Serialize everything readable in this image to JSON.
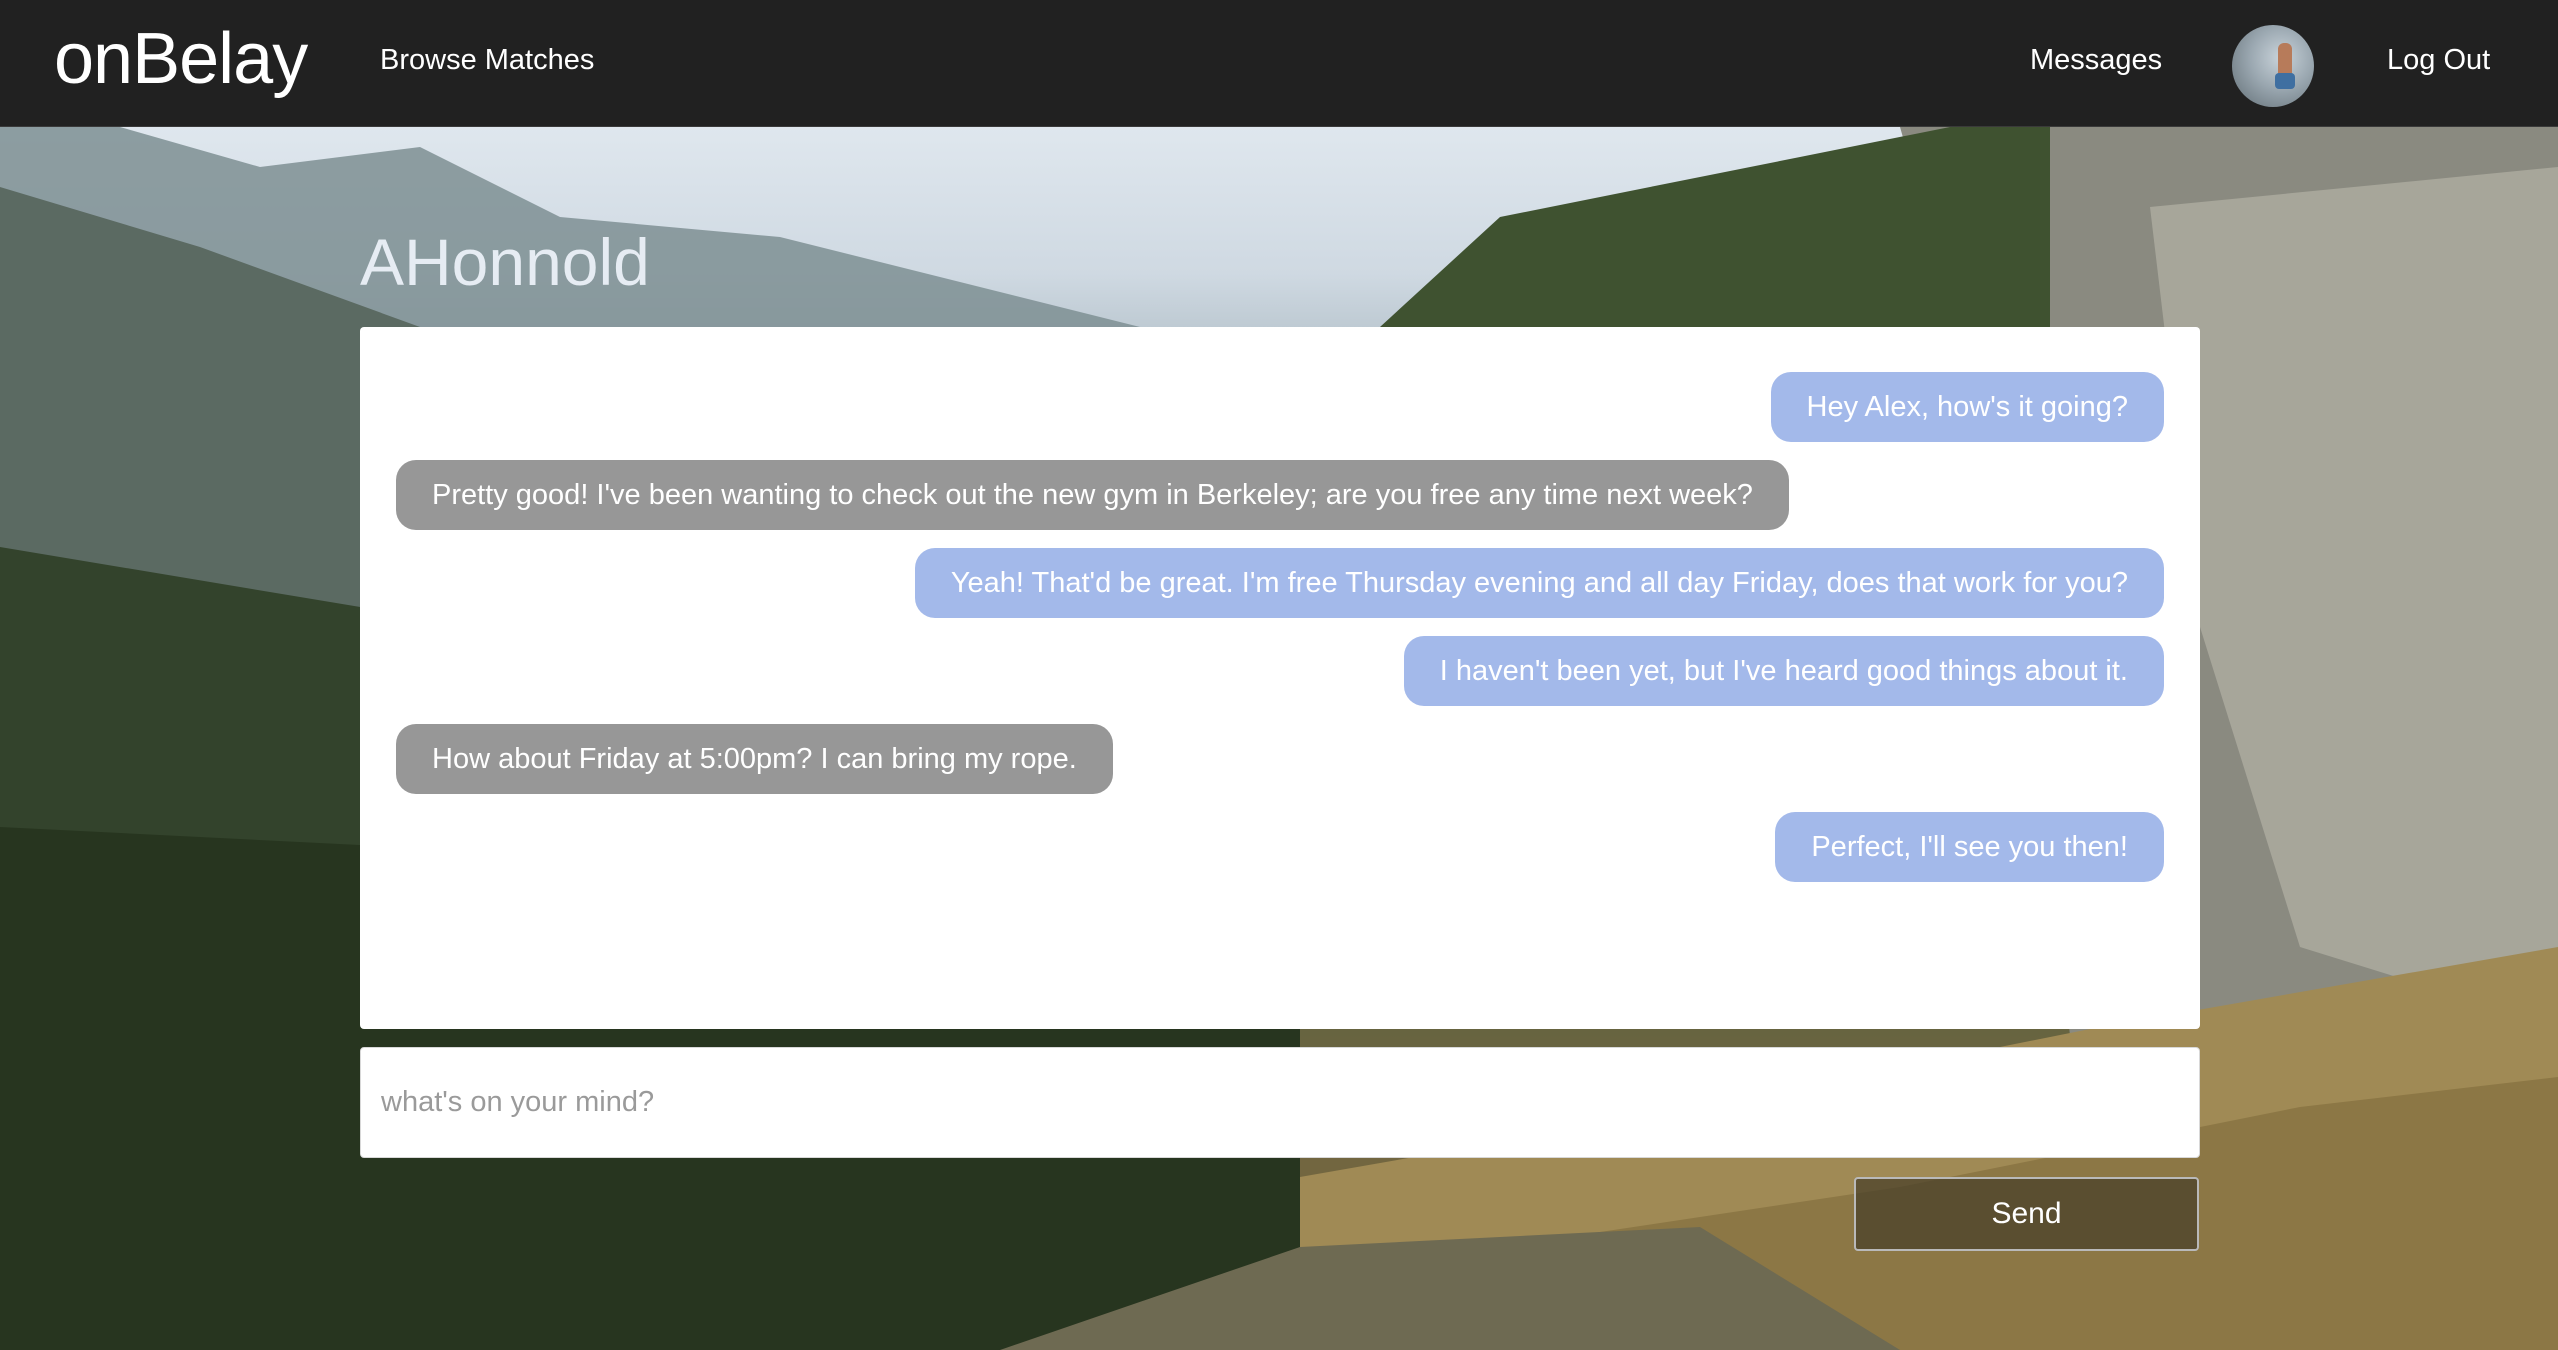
{
  "navbar": {
    "brand": "onBelay",
    "browse_label": "Browse Matches",
    "messages_label": "Messages",
    "logout_label": "Log Out"
  },
  "chat": {
    "partner_name": "AHonnold",
    "messages": [
      {
        "direction": "sent",
        "text": "Hey Alex, how's it going?"
      },
      {
        "direction": "received",
        "text": "Pretty good! I've been wanting to check out the new gym in Berkeley; are you free any time next week?"
      },
      {
        "direction": "sent",
        "text": "Yeah! That'd be great. I'm free Thursday evening and all day Friday, does that work for you?"
      },
      {
        "direction": "sent",
        "text": "I haven't been yet, but I've heard good things about it."
      },
      {
        "direction": "received",
        "text": "How about Friday at 5:00pm? I can bring my rope."
      },
      {
        "direction": "sent",
        "text": "Perfect, I'll see you then!"
      }
    ]
  },
  "composer": {
    "value": "",
    "placeholder": "what's on your mind?",
    "send_label": "Send"
  },
  "colors": {
    "navbar_bg": "#212121",
    "sent_bubble": "#a3b9ea",
    "received_bubble": "#979797",
    "panel_bg": "#ffffff"
  },
  "icons": {
    "avatar": "user-avatar-photo"
  }
}
